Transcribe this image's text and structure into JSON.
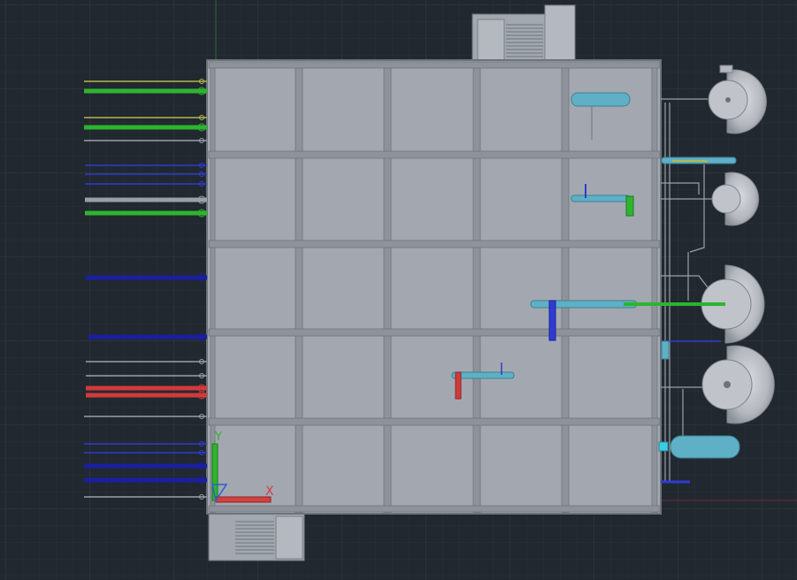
{
  "viewport": {
    "title": "",
    "background": "#212830",
    "grid_minor_color": "#2a313b",
    "grid_major_color": "#333b46"
  },
  "colors": {
    "floor": "#a3a8b0",
    "beam": "#8e939a",
    "outline": "#6e737a",
    "water": "#34d0e6",
    "vessel": "#5fb0c6",
    "green_pipe": "#2db52d",
    "yellow_pipe": "#b6b84a",
    "blue_pipe": "#2f3bd0",
    "navy_pipe": "#1a1fa0",
    "red_pipe": "#d23a3a",
    "gray_pipe": "#9aa0a8",
    "ucs_x": "#d24040",
    "ucs_y": "#2db52d",
    "ucs_z": "#2d5fd2"
  },
  "ucs_icon": {
    "x_label": "X",
    "y_label": "Y",
    "name": "ucs-icon"
  },
  "left_pipes": [
    {
      "color": "yellow_pipe",
      "kind": "thin"
    },
    {
      "color": "green_pipe",
      "kind": "thick"
    },
    {
      "color": "yellow_pipe",
      "kind": "thin"
    },
    {
      "color": "green_pipe",
      "kind": "thick"
    },
    {
      "color": "gray_pipe",
      "kind": "thin"
    },
    {
      "color": "blue_pipe",
      "kind": "thin"
    },
    {
      "color": "blue_pipe",
      "kind": "thin"
    },
    {
      "color": "blue_pipe",
      "kind": "thin"
    },
    {
      "color": "gray_pipe",
      "kind": "thick"
    },
    {
      "color": "green_pipe",
      "kind": "thick"
    },
    {
      "color": "navy_pipe",
      "kind": "thick"
    },
    {
      "color": "navy_pipe",
      "kind": "thick"
    },
    {
      "color": "gray_pipe",
      "kind": "thin"
    },
    {
      "color": "gray_pipe",
      "kind": "thin"
    },
    {
      "color": "red_pipe",
      "kind": "thick"
    },
    {
      "color": "red_pipe",
      "kind": "thick"
    },
    {
      "color": "gray_pipe",
      "kind": "thin"
    },
    {
      "color": "blue_pipe",
      "kind": "thin"
    },
    {
      "color": "blue_pipe",
      "kind": "thin"
    },
    {
      "color": "navy_pipe",
      "kind": "thick"
    },
    {
      "color": "navy_pipe",
      "kind": "thick"
    },
    {
      "color": "gray_pipe",
      "kind": "thin"
    }
  ],
  "tanks": [
    {
      "name": "tank-1"
    },
    {
      "name": "tank-2"
    },
    {
      "name": "tank-3"
    },
    {
      "name": "tank-4"
    }
  ]
}
